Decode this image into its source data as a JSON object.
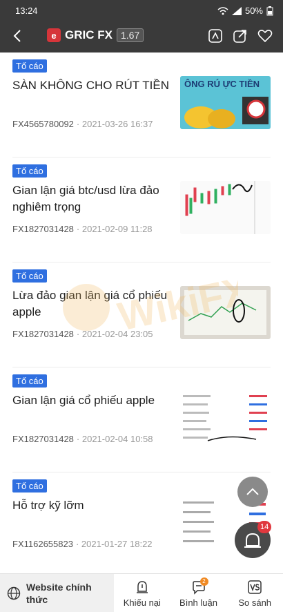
{
  "status": {
    "time": "13:24",
    "battery": "50%"
  },
  "nav": {
    "brand_logo_letter": "e",
    "brand_name": "GRIC FX",
    "score": "1.67"
  },
  "watermark": "WikiFX",
  "items": [
    {
      "tag": "Tố cáo",
      "title": "SÀN KHÔNG CHO RÚT TIỀN",
      "user": "FX4565780092",
      "date": "· 2021-03-26 16:37",
      "thumb_text": "ÔNG RÚ ỰC TIỀN"
    },
    {
      "tag": "Tố cáo",
      "title": "Gian lận giá btc/usd lừa đảo nghiêm trọng",
      "user": "FX1827031428",
      "date": "· 2021-02-09 11:28",
      "thumb_text": ""
    },
    {
      "tag": "Tố cáo",
      "title": "Lừa đảo gian lận giá cổ phiếu apple",
      "user": "FX1827031428",
      "date": "· 2021-02-04 23:05",
      "thumb_text": ""
    },
    {
      "tag": "Tố cáo",
      "title": "Gian lận giá cổ phiếu apple",
      "user": "FX1827031428",
      "date": "· 2021-02-04 10:58",
      "thumb_text": ""
    },
    {
      "tag": "Tố cáo",
      "title": "Hỗ trợ kỹ lỡm",
      "user": "FX1162655823",
      "date": "· 2021-01-27 18:22",
      "thumb_text": ""
    }
  ],
  "fab": {
    "bell_count": "14"
  },
  "bottom": {
    "website_label": "Website chính thức",
    "tabs": [
      {
        "label": "Khiếu nại",
        "icon": "complaint-icon"
      },
      {
        "label": "Bình luận",
        "icon": "comment-icon",
        "badge": "2"
      },
      {
        "label": "So sánh",
        "icon": "vs-icon"
      }
    ]
  },
  "colors": {
    "tag_bg": "#2f6fe0",
    "header_bg": "#3a3a3a",
    "badge_red": "#e0383e"
  }
}
